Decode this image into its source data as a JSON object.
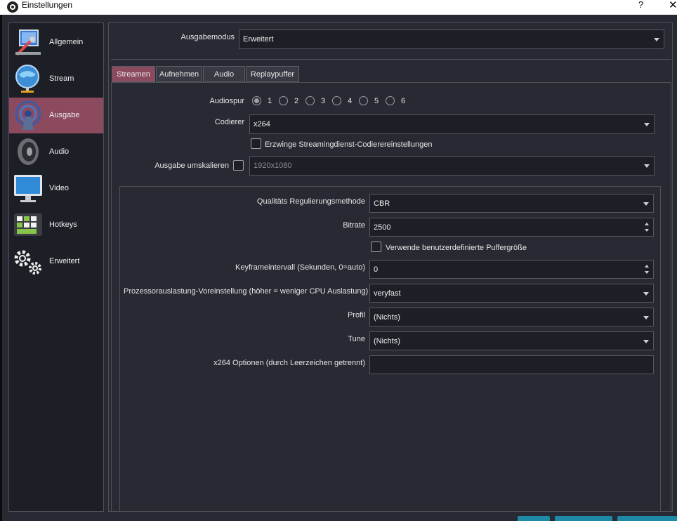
{
  "window": {
    "title": "Einstellungen",
    "help": "?",
    "close": "✕"
  },
  "sidebar": {
    "items": [
      {
        "label": "Allgemein",
        "icon": "general-icon"
      },
      {
        "label": "Stream",
        "icon": "stream-globe-icon"
      },
      {
        "label": "Ausgabe",
        "icon": "output-broadcast-icon",
        "active": true
      },
      {
        "label": "Audio",
        "icon": "speaker-icon"
      },
      {
        "label": "Video",
        "icon": "monitor-icon"
      },
      {
        "label": "Hotkeys",
        "icon": "keyboard-icon"
      },
      {
        "label": "Erweitert",
        "icon": "gears-icon"
      }
    ]
  },
  "output_mode": {
    "label": "Ausgabemodus",
    "value": "Erweitert"
  },
  "tabs": [
    {
      "label": "Streamen",
      "active": true
    },
    {
      "label": "Aufnehmen"
    },
    {
      "label": "Audio"
    },
    {
      "label": "Replaypuffer"
    }
  ],
  "streaming": {
    "audio_track": {
      "label": "Audiospur",
      "options": [
        "1",
        "2",
        "3",
        "4",
        "5",
        "6"
      ],
      "selected": "1"
    },
    "encoder": {
      "label": "Codierer",
      "value": "x264"
    },
    "enforce": {
      "label": "Erzwinge Streamingdienst-Codierereinstellungen",
      "checked": false
    },
    "rescale": {
      "label": "Ausgabe umskalieren",
      "checked": false,
      "value": "1920x1080"
    }
  },
  "encoder_settings": {
    "rate_control": {
      "label": "Qualitäts Regulierungsmethode",
      "value": "CBR"
    },
    "bitrate": {
      "label": "Bitrate",
      "value": "2500"
    },
    "custom_buffer": {
      "label": "Verwende benutzerdefinierte Puffergröße",
      "checked": false
    },
    "keyframe": {
      "label": "Keyframeintervall (Sekunden, 0=auto)",
      "value": "0"
    },
    "preset": {
      "label": "Prozessorauslastung-Voreinstellung (höher = weniger CPU Auslastung)",
      "value": "veryfast"
    },
    "profile": {
      "label": "Profil",
      "value": "(Nichts)"
    },
    "tune": {
      "label": "Tune",
      "value": "(Nichts)"
    },
    "x264_options": {
      "label": "x264 Optionen (durch Leerzeichen getrennt)",
      "value": ""
    }
  },
  "colors": {
    "accent": "#8c4a5f",
    "background": "#272a33",
    "field": "#1d1f26",
    "button": "#1f8aa8"
  }
}
